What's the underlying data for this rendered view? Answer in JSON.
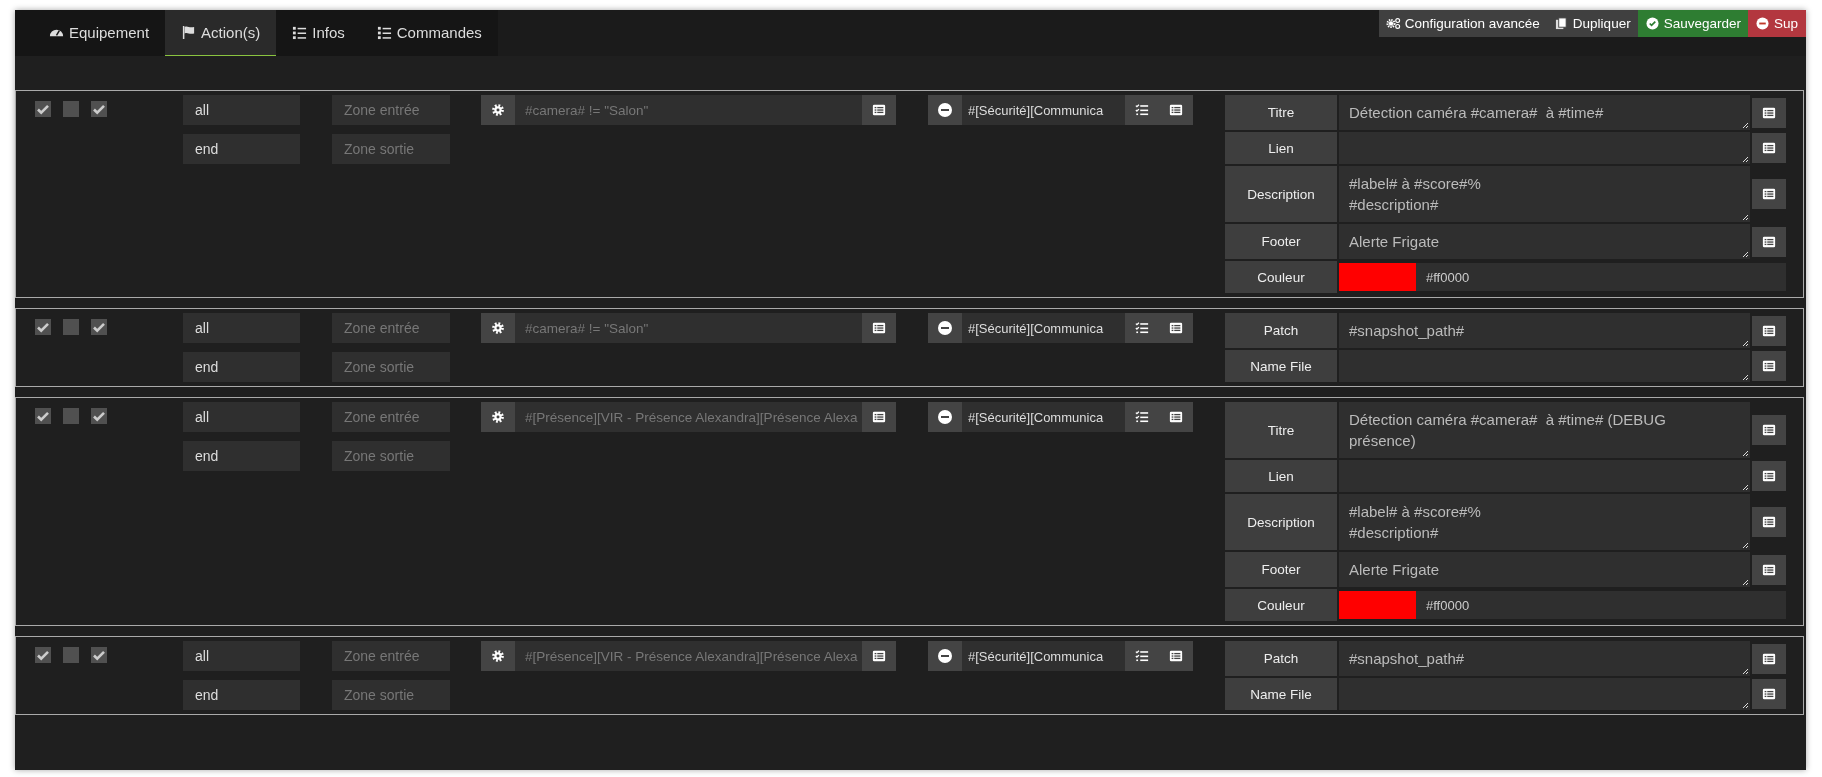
{
  "tabs": [
    {
      "label": "Equipement",
      "kind": "equipment",
      "selected": false
    },
    {
      "label": "Action(s)",
      "kind": "actions",
      "selected": true
    },
    {
      "label": "Infos",
      "kind": "infos",
      "selected": false
    },
    {
      "label": "Commandes",
      "kind": "commands",
      "selected": false
    }
  ],
  "header_buttons": [
    {
      "label": "Configuration avancée",
      "kind": "config"
    },
    {
      "label": "Dupliquer",
      "kind": "duplicate"
    },
    {
      "label": "Sauvegarder",
      "kind": "save"
    },
    {
      "label": "Sup",
      "kind": "delete"
    }
  ],
  "actions": [
    {
      "checks": [
        {
          "checked": true
        },
        {
          "checked": false
        },
        {
          "checked": true
        }
      ],
      "trigger": "all",
      "trigger_end": "end",
      "zone_in_placeholder": "Zone entrée",
      "zone_out_placeholder": "Zone sortie",
      "condition": "#camera# != \"Salon\"",
      "command": "#[Sécurité][Communica",
      "options": [
        {
          "label": "Titre",
          "kind": "text",
          "value": "Détection caméra #camera#  à #time#"
        },
        {
          "label": "Lien",
          "kind": "text"
        },
        {
          "label": "Description",
          "kind": "text",
          "value": "#label# à #score#%\n#description#"
        },
        {
          "label": "Footer",
          "kind": "text",
          "value": "Alerte Frigate"
        },
        {
          "label": "Couleur",
          "kind": "color",
          "color": "#ff0000",
          "value": "#ff0000"
        }
      ]
    },
    {
      "checks": [
        {
          "checked": true
        },
        {
          "checked": false
        },
        {
          "checked": true
        }
      ],
      "trigger": "all",
      "trigger_end": "end",
      "zone_in_placeholder": "Zone entrée",
      "zone_out_placeholder": "Zone sortie",
      "condition": "#camera# != \"Salon\"",
      "command": "#[Sécurité][Communica",
      "options": [
        {
          "label": "Patch",
          "kind": "text",
          "value": "#snapshot_path#"
        },
        {
          "label": "Name File",
          "kind": "text"
        }
      ]
    },
    {
      "checks": [
        {
          "checked": true
        },
        {
          "checked": false
        },
        {
          "checked": true
        }
      ],
      "trigger": "all",
      "trigger_end": "end",
      "zone_in_placeholder": "Zone entrée",
      "zone_out_placeholder": "Zone sortie",
      "condition": "#[Présence][VIR - Présence Alexandra][Présence Alexa",
      "command": "#[Sécurité][Communica",
      "options": [
        {
          "label": "Titre",
          "kind": "text",
          "value": "Détection caméra #camera#  à #time# (DEBUG présence)"
        },
        {
          "label": "Lien",
          "kind": "text"
        },
        {
          "label": "Description",
          "kind": "text",
          "value": "#label# à #score#%\n#description#"
        },
        {
          "label": "Footer",
          "kind": "text",
          "value": "Alerte Frigate"
        },
        {
          "label": "Couleur",
          "kind": "color",
          "color": "#ff0000",
          "value": "#ff0000"
        }
      ]
    },
    {
      "checks": [
        {
          "checked": true
        },
        {
          "checked": false
        },
        {
          "checked": true
        }
      ],
      "trigger": "all",
      "trigger_end": "end",
      "zone_in_placeholder": "Zone entrée",
      "zone_out_placeholder": "Zone sortie",
      "condition": "#[Présence][VIR - Présence Alexandra][Présence Alexa",
      "command": "#[Sécurité][Communica",
      "options": [
        {
          "label": "Patch",
          "kind": "text",
          "value": "#snapshot_path#"
        },
        {
          "label": "Name File",
          "kind": "text"
        }
      ]
    }
  ]
}
